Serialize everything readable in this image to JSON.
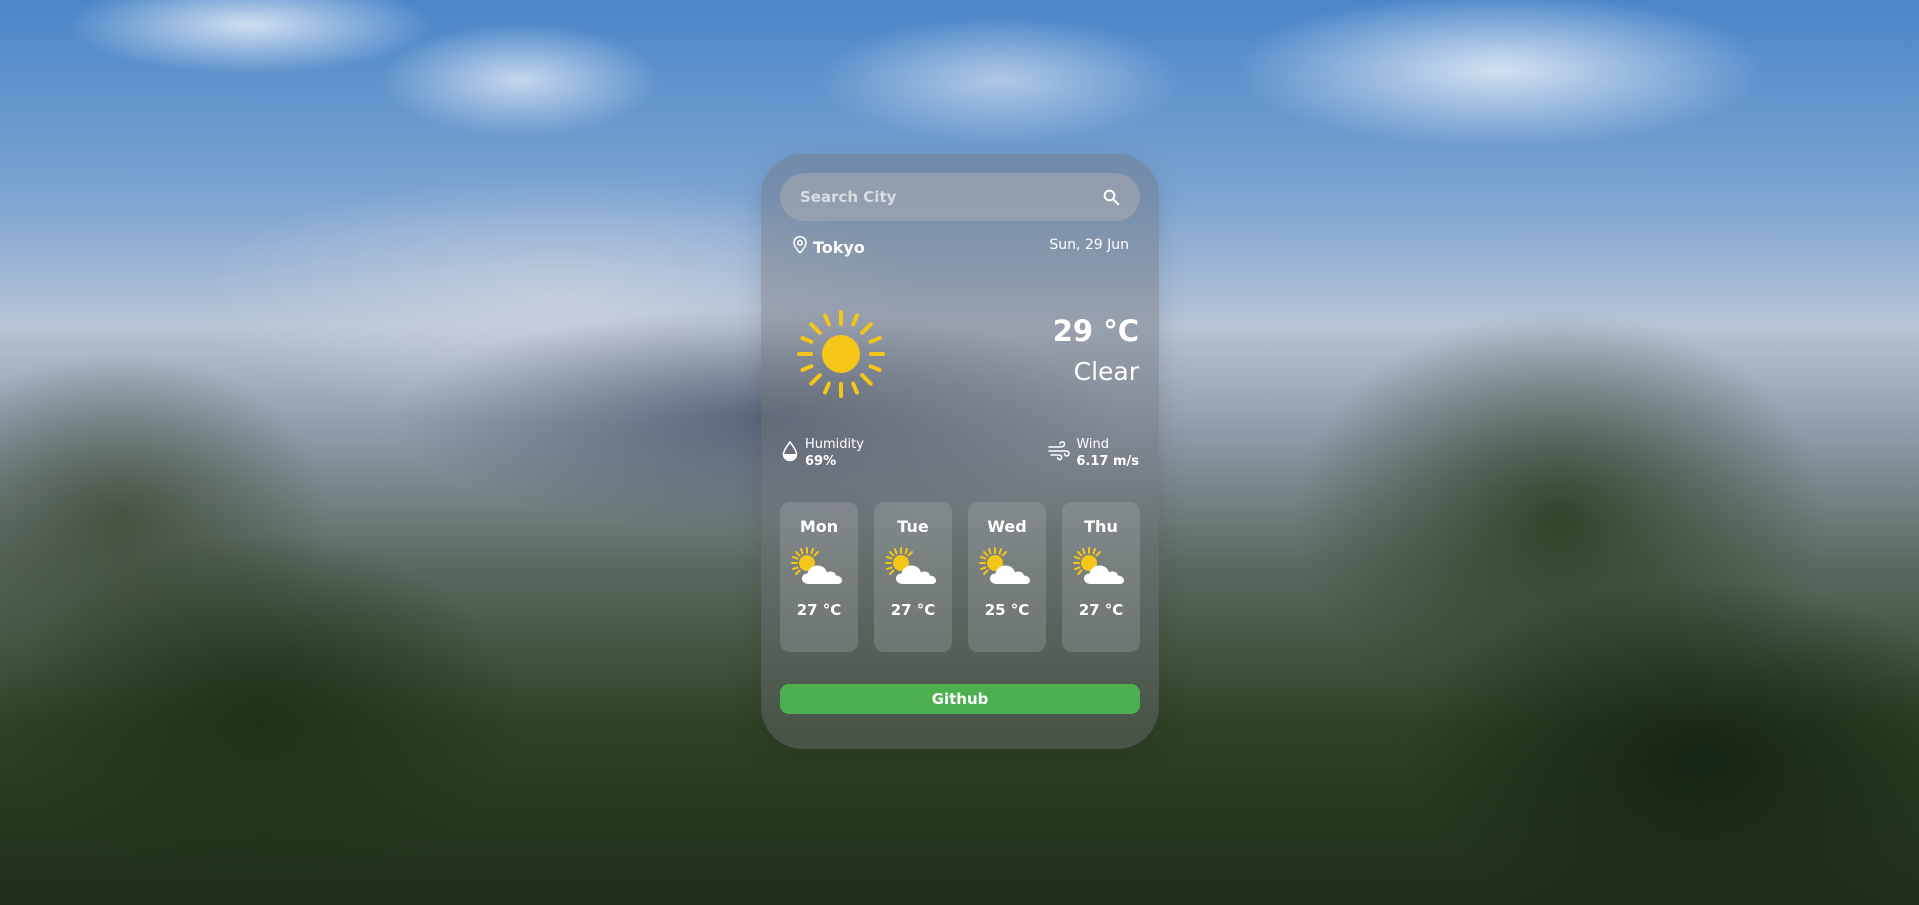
{
  "search": {
    "placeholder": "Search City",
    "icon": "search-icon"
  },
  "location": {
    "city": "Tokyo",
    "icon": "map-pin-icon"
  },
  "date": "Sun, 29 Jun",
  "current": {
    "temperature": "29 °C",
    "condition": "Clear",
    "icon": "sun-icon"
  },
  "humidity": {
    "label": "Humidity",
    "value": "69%",
    "icon": "water-drop-icon"
  },
  "wind": {
    "label": "Wind",
    "value": "6.17 m/s",
    "icon": "wind-icon"
  },
  "forecast": [
    {
      "day": "Mon",
      "temp": "27 °C",
      "icon": "partly-cloudy-icon"
    },
    {
      "day": "Tue",
      "temp": "27 °C",
      "icon": "partly-cloudy-icon"
    },
    {
      "day": "Wed",
      "temp": "25 °C",
      "icon": "partly-cloudy-icon"
    },
    {
      "day": "Thu",
      "temp": "27 °C",
      "icon": "partly-cloudy-icon"
    }
  ],
  "github_label": "Github",
  "colors": {
    "accent_green": "#4caf50",
    "sun": "#f5c518",
    "text": "#ffffff"
  }
}
